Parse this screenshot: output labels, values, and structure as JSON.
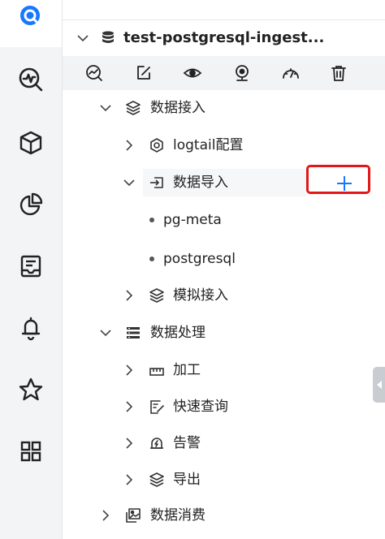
{
  "colors": {
    "accent": "#1677ff",
    "highlight_border": "#e01818",
    "rail_bg": "#f3f4f6",
    "toolbar_bg": "#f2f3f5"
  },
  "rail": {
    "items": [
      {
        "icon": "sls-logo-icon",
        "active": true
      },
      {
        "icon": "search-monitor-icon"
      },
      {
        "icon": "cube-icon"
      },
      {
        "icon": "pie-chart-icon"
      },
      {
        "icon": "inbox-icon"
      },
      {
        "icon": "bell-icon"
      },
      {
        "icon": "star-icon"
      },
      {
        "icon": "grid-icon"
      }
    ]
  },
  "project": {
    "name": "test-postgresql-ingest...",
    "icon": "database-icon"
  },
  "toolbar": {
    "buttons": [
      {
        "icon": "query-analysis-icon"
      },
      {
        "icon": "edit-icon"
      },
      {
        "icon": "eye-icon"
      },
      {
        "icon": "webcam-icon"
      },
      {
        "icon": "dashboard-gauge-icon"
      },
      {
        "icon": "trash-icon"
      }
    ]
  },
  "tree": {
    "data_ingest": {
      "label": "数据接入",
      "icon": "layers-icon"
    },
    "logtail": {
      "label": "logtail配置",
      "icon": "hexagon-icon"
    },
    "data_import": {
      "label": "数据导入",
      "icon": "import-icon"
    },
    "pg_meta": {
      "label": "pg-meta"
    },
    "postgresql": {
      "label": "postgresql"
    },
    "simulated": {
      "label": "模拟接入",
      "icon": "layers-icon"
    },
    "processing": {
      "label": "数据处理",
      "icon": "list-icon"
    },
    "processing_children": {
      "jiagong": {
        "label": "加工",
        "icon": "ruler-icon"
      },
      "quick_query": {
        "label": "快速查询",
        "icon": "query-doc-icon"
      },
      "alert": {
        "label": "告警",
        "icon": "alarm-icon"
      },
      "export": {
        "label": "导出",
        "icon": "layers-icon"
      }
    },
    "consumption": {
      "label": "数据消费",
      "icon": "image-stack-icon"
    }
  },
  "add_button": {
    "symbol": "+",
    "icon": "plus-icon"
  }
}
